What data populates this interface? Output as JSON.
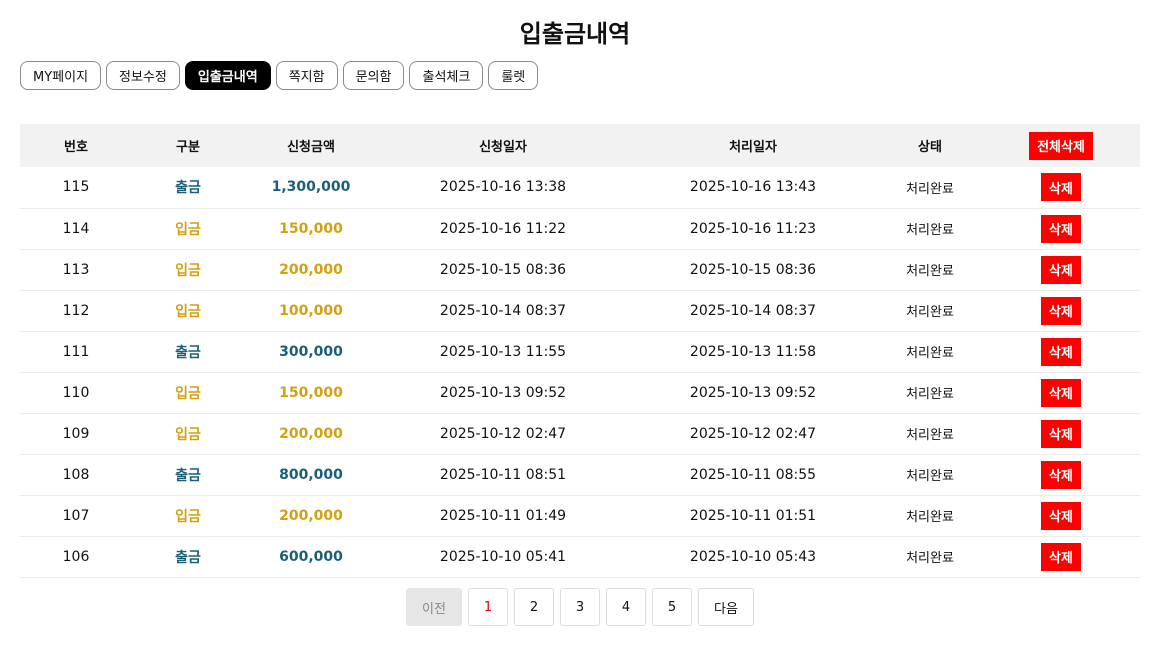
{
  "page_title": "입출금내역",
  "tabs": [
    {
      "label": "MY페이지"
    },
    {
      "label": "정보수정"
    },
    {
      "label": "입출금내역",
      "active": true
    },
    {
      "label": "쪽지함"
    },
    {
      "label": "문의함"
    },
    {
      "label": "출석체크"
    },
    {
      "label": "룰렛"
    }
  ],
  "table": {
    "headers": [
      "번호",
      "구분",
      "신청금액",
      "신청일자",
      "처리일자",
      "상태"
    ],
    "delete_all_label": "전체삭제",
    "delete_label": "삭제",
    "rows": [
      {
        "no": "115",
        "kind": "출금",
        "amount": "1,300,000",
        "requested": "2025-10-16 13:38",
        "processed": "2025-10-16 13:43",
        "status": "처리완료"
      },
      {
        "no": "114",
        "kind": "입금",
        "amount": "150,000",
        "requested": "2025-10-16 11:22",
        "processed": "2025-10-16 11:23",
        "status": "처리완료"
      },
      {
        "no": "113",
        "kind": "입금",
        "amount": "200,000",
        "requested": "2025-10-15 08:36",
        "processed": "2025-10-15 08:36",
        "status": "처리완료"
      },
      {
        "no": "112",
        "kind": "입금",
        "amount": "100,000",
        "requested": "2025-10-14 08:37",
        "processed": "2025-10-14 08:37",
        "status": "처리완료"
      },
      {
        "no": "111",
        "kind": "출금",
        "amount": "300,000",
        "requested": "2025-10-13 11:55",
        "processed": "2025-10-13 11:58",
        "status": "처리완료"
      },
      {
        "no": "110",
        "kind": "입금",
        "amount": "150,000",
        "requested": "2025-10-13 09:52",
        "processed": "2025-10-13 09:52",
        "status": "처리완료"
      },
      {
        "no": "109",
        "kind": "입금",
        "amount": "200,000",
        "requested": "2025-10-12 02:47",
        "processed": "2025-10-12 02:47",
        "status": "처리완료"
      },
      {
        "no": "108",
        "kind": "출금",
        "amount": "800,000",
        "requested": "2025-10-11 08:51",
        "processed": "2025-10-11 08:55",
        "status": "처리완료"
      },
      {
        "no": "107",
        "kind": "입금",
        "amount": "200,000",
        "requested": "2025-10-11 01:49",
        "processed": "2025-10-11 01:51",
        "status": "처리완료"
      },
      {
        "no": "106",
        "kind": "출금",
        "amount": "600,000",
        "requested": "2025-10-10 05:41",
        "processed": "2025-10-10 05:43",
        "status": "처리완료"
      }
    ]
  },
  "pagination": {
    "prev_label": "이전",
    "pages": [
      "1",
      "2",
      "3",
      "4",
      "5"
    ],
    "current": "1",
    "next_label": "다음"
  },
  "colors": {
    "withdraw": "#1a5f7a",
    "deposit": "#d4a012",
    "delete": "#ff0000",
    "active_tab": "#000000",
    "current_page": "#e00000"
  }
}
